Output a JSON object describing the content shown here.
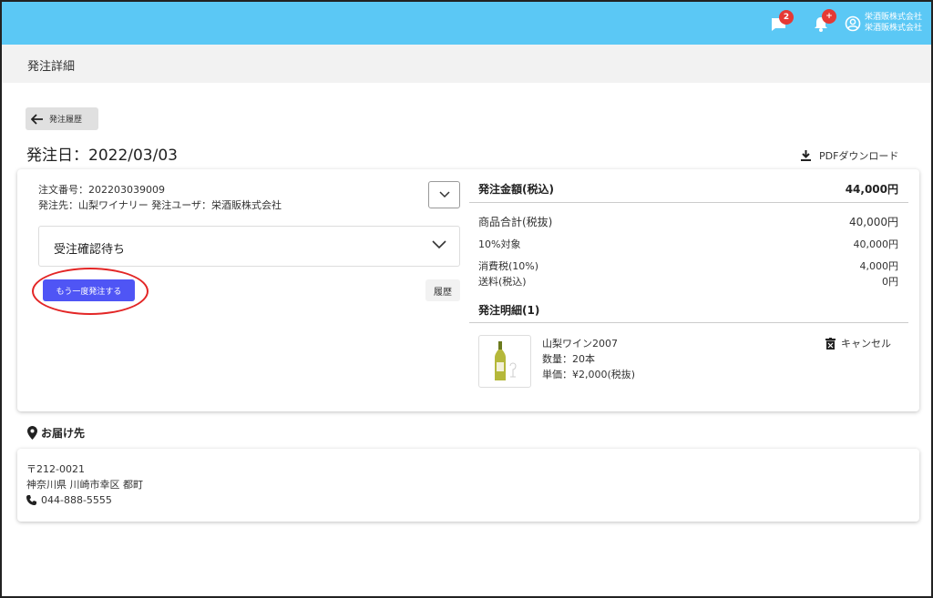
{
  "header": {
    "messages_badge": "2",
    "notifications_badge": "+",
    "company_line1": "栄酒販株式会社",
    "company_line2": "栄酒販株式会社"
  },
  "subheader": {
    "title": "発注詳細"
  },
  "back_button": {
    "label": "発注履歴"
  },
  "order": {
    "date": "発注日：2022/03/03",
    "pdf_label": "PDFダウンロード",
    "number": "注文番号：202203039009",
    "supplier_line": "発注先：山梨ワイナリー 発注ユーザ：栄酒販株式会社",
    "status": "受注確認待ち",
    "reorder_label": "もう一度発注する",
    "history_label": "履歴"
  },
  "summary": {
    "total_label": "発注金額(税込)",
    "total_value": "44,000円",
    "subtotal_label": "商品合計(税抜)",
    "subtotal_value": "40,000円",
    "taxable_label": "10%対象",
    "taxable_value": "40,000円",
    "tax_label": "消費税(10%)",
    "tax_value": "4,000円",
    "shipping_label": "送料(税込)",
    "shipping_value": "0円"
  },
  "details": {
    "title": "発注明細(1)",
    "item_name": "山梨ワイン2007",
    "quantity": "数量：20本",
    "unit_price": "単価：¥2,000(税抜)",
    "cancel_label": "キャンセル"
  },
  "delivery": {
    "title": "お届け先",
    "postal": "〒212-0021",
    "address": "神奈川県 川崎市幸区 都町",
    "phone": "044-888-5555"
  },
  "colors": {
    "topbar": "#5bc8f5",
    "primary_button": "#4f55f5",
    "badge": "#e53935",
    "highlight_ring": "#e32626"
  }
}
